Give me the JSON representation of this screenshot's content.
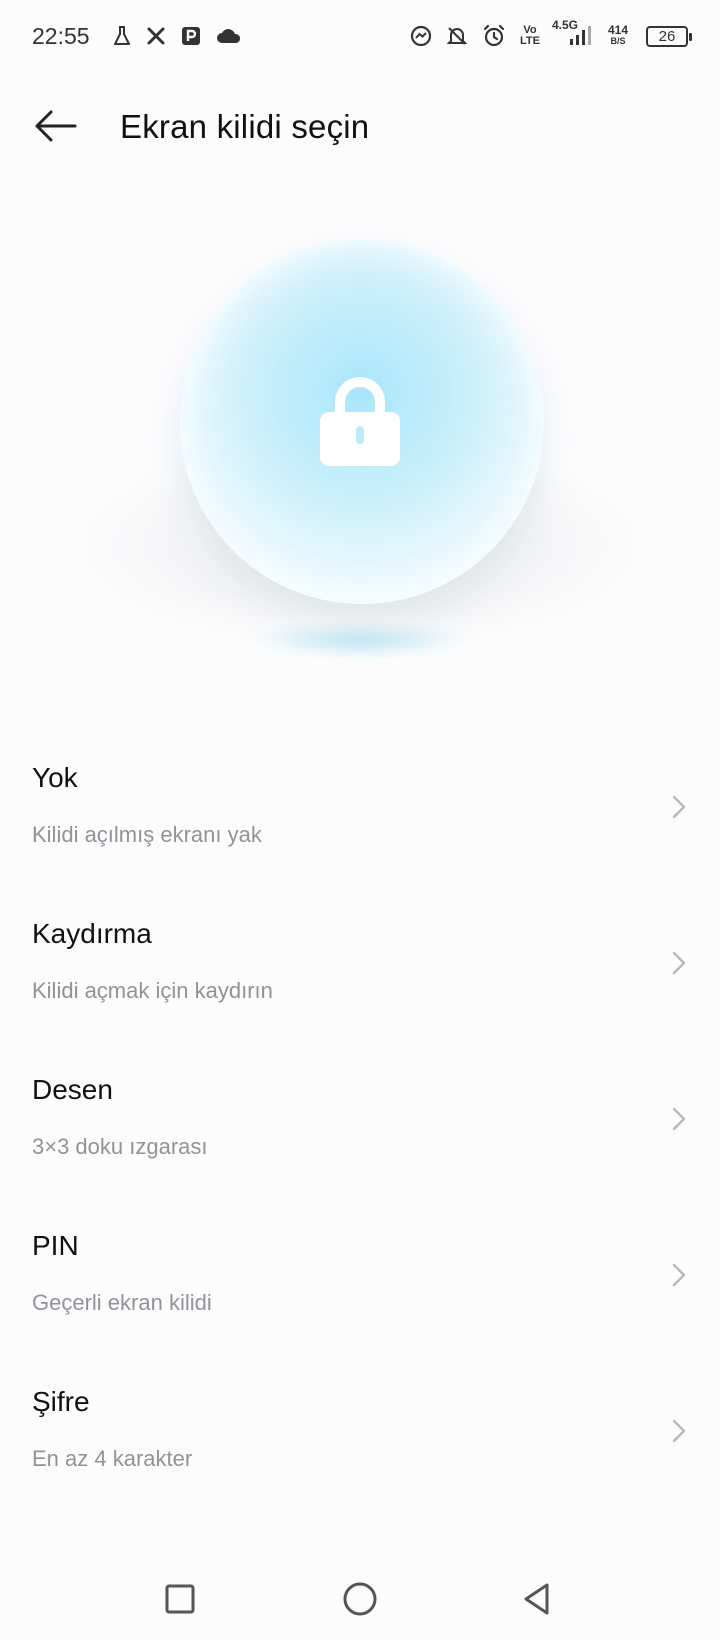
{
  "status_bar": {
    "time": "22:55",
    "left_icons": [
      "flask-icon",
      "x-icon",
      "parking-icon",
      "cloud-icon"
    ],
    "right_icons": [
      "messenger-icon",
      "bell-off-icon",
      "alarm-icon",
      "volte-icon",
      "signal-icon"
    ],
    "volte_top": "Vo",
    "volte_bottom": "LTE",
    "network_type": "4.5G",
    "speed_value": "414",
    "speed_unit": "B/S",
    "battery_level": "26"
  },
  "header": {
    "back_icon": "arrow-left-icon",
    "title": "Ekran kilidi seçin"
  },
  "hero": {
    "icon": "lock-icon",
    "accent_color": "#a9e6f9"
  },
  "options": [
    {
      "title": "Yok",
      "subtitle": "Kilidi açılmış ekranı yak"
    },
    {
      "title": "Kaydırma",
      "subtitle": "Kilidi açmak için kaydırın"
    },
    {
      "title": "Desen",
      "subtitle": "3×3 doku ızgarası"
    },
    {
      "title": "PIN",
      "subtitle": "Geçerli ekran kilidi"
    },
    {
      "title": "Şifre",
      "subtitle": "En az 4 karakter"
    }
  ],
  "nav_bar": {
    "recents_icon": "square-icon",
    "home_icon": "circle-icon",
    "back_icon": "triangle-back-icon"
  },
  "colors": {
    "background": "#fcfcfd",
    "title_text": "#111111",
    "subtitle_text": "#8f9399",
    "chevron": "#b5b8bd"
  }
}
